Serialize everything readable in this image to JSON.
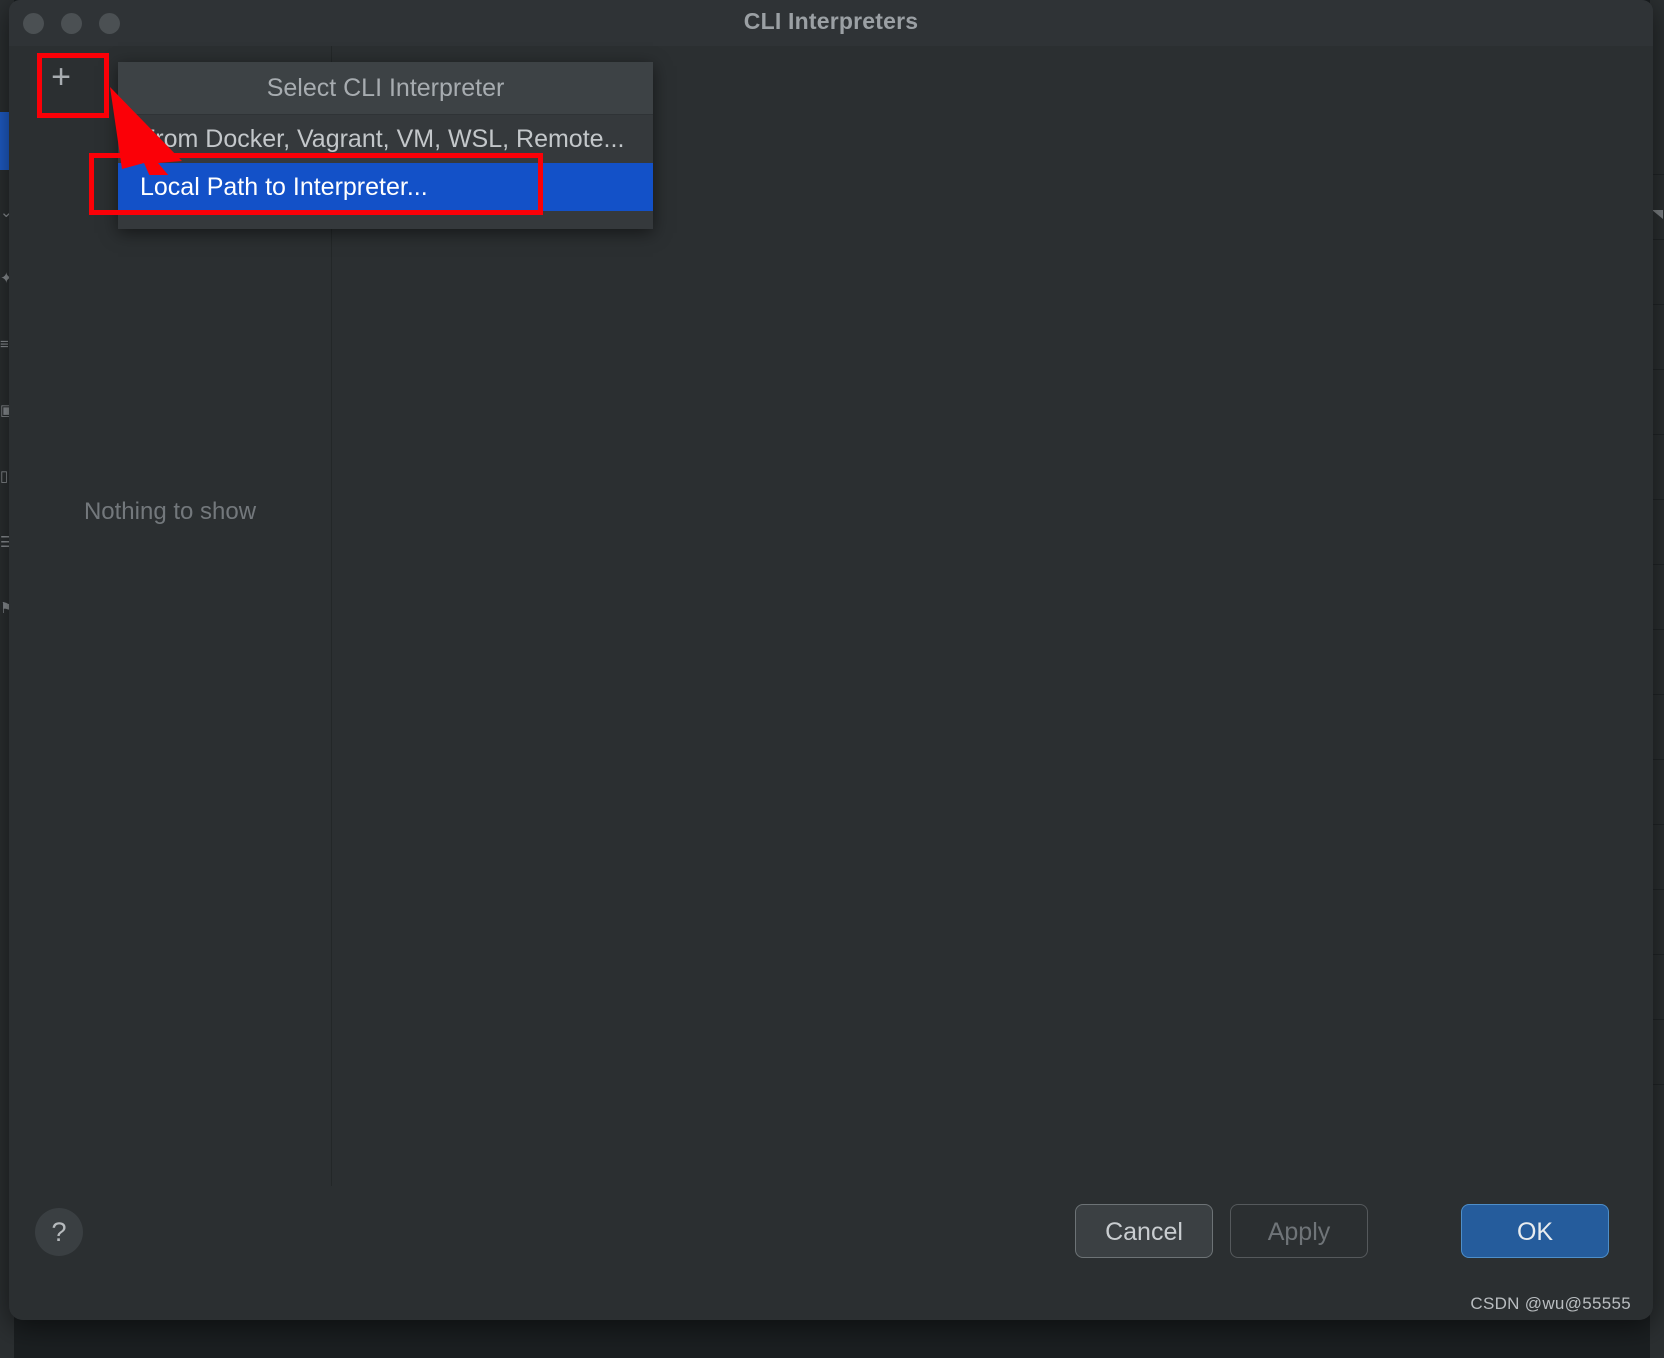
{
  "window": {
    "title": "CLI Interpreters",
    "traffic_lights": [
      "close-button",
      "minimize-button",
      "zoom-button"
    ]
  },
  "toolbar": {
    "add_label": "+"
  },
  "left_pane": {
    "empty_text": "Nothing to show"
  },
  "popup": {
    "header": "Select CLI Interpreter",
    "items": [
      {
        "label": "From Docker, Vagrant, VM, WSL, Remote...",
        "selected": false
      },
      {
        "label": "Local Path to Interpreter...",
        "selected": true
      }
    ]
  },
  "footer": {
    "help_label": "?",
    "cancel_label": "Cancel",
    "apply_label": "Apply",
    "ok_label": "OK",
    "watermark": "CSDN @wu@55555"
  },
  "colors": {
    "window_bg": "#2b2f31",
    "titlebar_bg": "#2f3336",
    "popup_bg": "#35393c",
    "popup_header_bg": "#3d4245",
    "selection_blue": "#1351c8",
    "ok_blue": "#255c9c",
    "annotation_red": "#fb0007",
    "text_primary": "#c3c7ca",
    "text_muted": "#73787c"
  },
  "background_sidebar_glyphs": [
    "⌄",
    "✦",
    "≡",
    "▣",
    "▯",
    "☰",
    "⚑"
  ]
}
